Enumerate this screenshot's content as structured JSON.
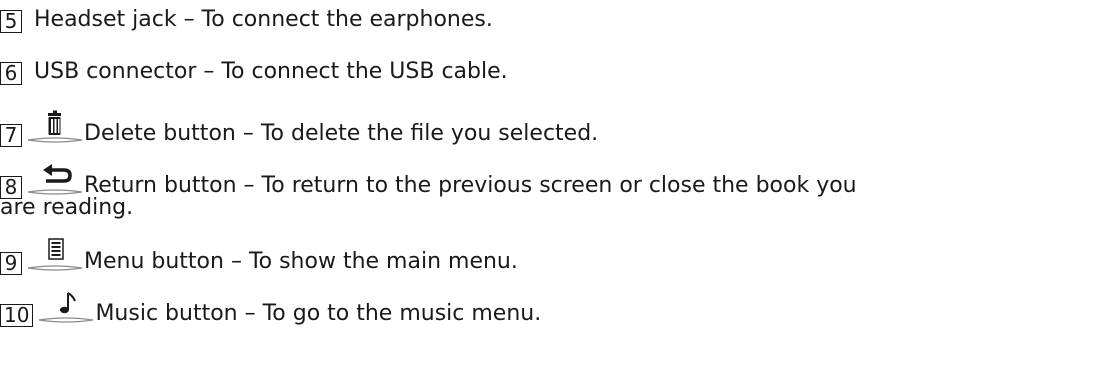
{
  "items": [
    {
      "num": "5",
      "text": "Headset jack – To connect the earphones.",
      "icon": null
    },
    {
      "num": "6",
      "text": "USB connector – To connect the USB cable.",
      "icon": null
    },
    {
      "num": "7",
      "text": "Delete button – To delete the file you selected.",
      "icon": "trash-button-icon"
    },
    {
      "num": "8",
      "text": "Return button – To return to the previous screen or close the book you",
      "continuation": "are reading.",
      "icon": "return-arrow-button-icon"
    },
    {
      "num": "9",
      "text": "Menu button – To show the main menu.",
      "icon": "menu-list-button-icon"
    },
    {
      "num": "10",
      "text": "Music button – To go to the music menu.",
      "icon": "music-note-button-icon"
    }
  ]
}
